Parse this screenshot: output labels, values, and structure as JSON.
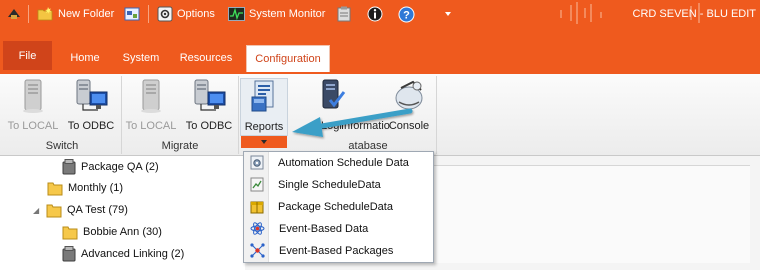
{
  "quick_access": {
    "new_folder": "New Folder",
    "options": "Options",
    "system_monitor": "System Monitor"
  },
  "window_title": "CRD SEVEN - BLU EDIT",
  "tabs": [
    "File",
    "Home",
    "System",
    "Resources",
    "Configuration"
  ],
  "ribbon": {
    "switch_group": {
      "label": "Switch",
      "buttons": [
        "To LOCAL",
        "To ODBC"
      ]
    },
    "migrate_group": {
      "label": "Migrate",
      "buttons": [
        "To LOCAL",
        "To ODBC"
      ]
    },
    "database_group": {
      "label": "atabase",
      "buttons": [
        "Reports",
        "Logi",
        "Informatio",
        "Console"
      ]
    }
  },
  "tree": [
    {
      "label": "Package QA (2)",
      "icon": "package-icon"
    },
    {
      "label": "Monthly (1)",
      "icon": "folder-icon"
    },
    {
      "label": "QA Test (79)",
      "icon": "folder-icon"
    },
    {
      "label": "Bobbie Ann (30)",
      "icon": "folder-icon"
    },
    {
      "label": "Advanced Linking (2)",
      "icon": "package-icon"
    }
  ],
  "reports_menu": [
    {
      "label": "Automation Schedule Data",
      "icon": "gear-document-icon"
    },
    {
      "label": "Single ScheduleData",
      "icon": "chart-document-icon"
    },
    {
      "label": "Package ScheduleData",
      "icon": "package-icon"
    },
    {
      "label": "Event-Based Data",
      "icon": "atom-icon"
    },
    {
      "label": "Event-Based Packages",
      "icon": "network-icon"
    }
  ],
  "colors": {
    "ribbon_orange": "#ef5a1e",
    "file_tab": "#d0441a",
    "callout_arrow": "#3a9fc7"
  }
}
